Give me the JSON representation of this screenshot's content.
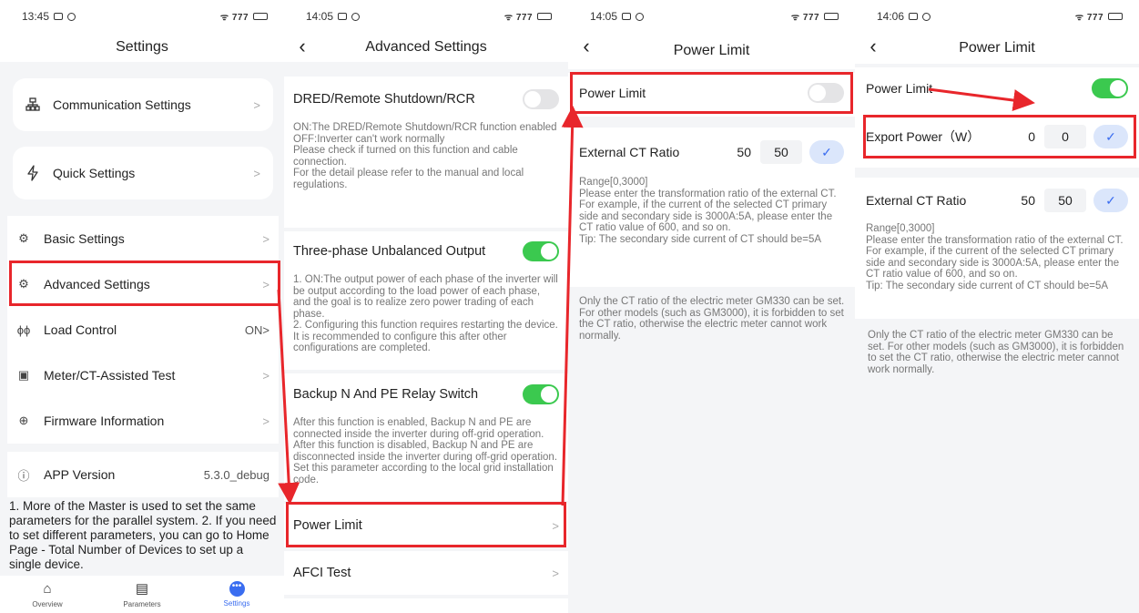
{
  "panel1": {
    "status_time": "13:45",
    "status_right": "ᯤ 777",
    "title": "Settings",
    "cards": [
      {
        "icon": "network-icon",
        "label": "Communication Settings"
      },
      {
        "icon": "lightning-icon",
        "label": "Quick Settings"
      }
    ],
    "list": [
      {
        "label": "Basic Settings",
        "value": ""
      },
      {
        "label": "Advanced Settings",
        "value": ""
      },
      {
        "label": "Load Control",
        "value": "ON>"
      },
      {
        "label": "Meter/CT-Assisted Test",
        "value": ""
      },
      {
        "label": "Firmware Information",
        "value": ""
      }
    ],
    "app_version_label": "APP Version",
    "app_version_value": "5.3.0_debug",
    "note": "1. More of the Master is used to set the same parameters for the parallel system. 2. If you need to set different parameters, you can go to Home Page - Total Number of Devices to set up a single device.",
    "tabs": [
      "Overview",
      "Parameters",
      "Settings"
    ]
  },
  "panel2": {
    "status_time": "14:05",
    "title": "Advanced Settings",
    "sections": [
      {
        "title": "DRED/Remote Shutdown/RCR",
        "toggle": "off",
        "desc": "ON:The DRED/Remote Shutdown/RCR function enabled\nOFF:Inverter can't work normally\nPlease check if turned on this function and cable connection.\nFor the detail please refer to the manual and local regulations."
      },
      {
        "title": "Three-phase Unbalanced Output",
        "toggle": "on",
        "desc": "1. ON:The output power of each phase of the inverter will be output according to the load power of each phase, and the goal is to realize zero power trading of each phase.\n2. Configuring this function requires restarting the device. It is recommended to configure this after other configurations are completed."
      },
      {
        "title": "Backup N And PE Relay Switch",
        "toggle": "on",
        "desc": "After this function is enabled, Backup N and PE are connected inside the inverter during off-grid operation. After this function is disabled, Backup N and PE are disconnected inside the inverter during off-grid operation. Set this parameter according to the local grid installation code."
      }
    ],
    "power_limit": "Power Limit",
    "afci": "AFCI Test"
  },
  "panel3": {
    "status_time": "14:05",
    "title": "Power Limit",
    "power_limit_label": "Power Limit",
    "ct_label": "External CT Ratio",
    "ct_value": "50",
    "ct_input": "50",
    "ct_desc": "Range[0,3000]\nPlease enter the transformation ratio of the external CT. For example, if the current of the selected CT primary side and secondary side is 3000A:5A, please enter the CT ratio value of 600, and so on.\nTip: The secondary side current of CT should be=5A",
    "meter_note": "Only the CT ratio of the electric meter GM330 can be set. For other models (such as GM3000), it is forbidden to set the CT ratio, otherwise the electric meter cannot work normally."
  },
  "panel4": {
    "status_time": "14:06",
    "title": "Power Limit",
    "power_limit_label": "Power Limit",
    "export_label": "Export Power（W）",
    "export_value": "0",
    "export_input": "0",
    "ct_label": "External CT Ratio",
    "ct_value": "50",
    "ct_input": "50",
    "ct_desc": "Range[0,3000]\nPlease enter the transformation ratio of the external CT. For example, if the current of the selected CT primary side and secondary side is 3000A:5A, please enter the CT ratio value of 600, and so on.\nTip: The secondary side current of CT should be=5A",
    "meter_note": "Only the CT ratio of the electric meter GM330 can be set. For other models (such as GM3000), it is forbidden to set the CT ratio, otherwise the electric meter cannot work normally."
  },
  "colors": {
    "accent": "#3a6df0",
    "toggle_on": "#3bc94f",
    "highlight": "#e8262b"
  }
}
